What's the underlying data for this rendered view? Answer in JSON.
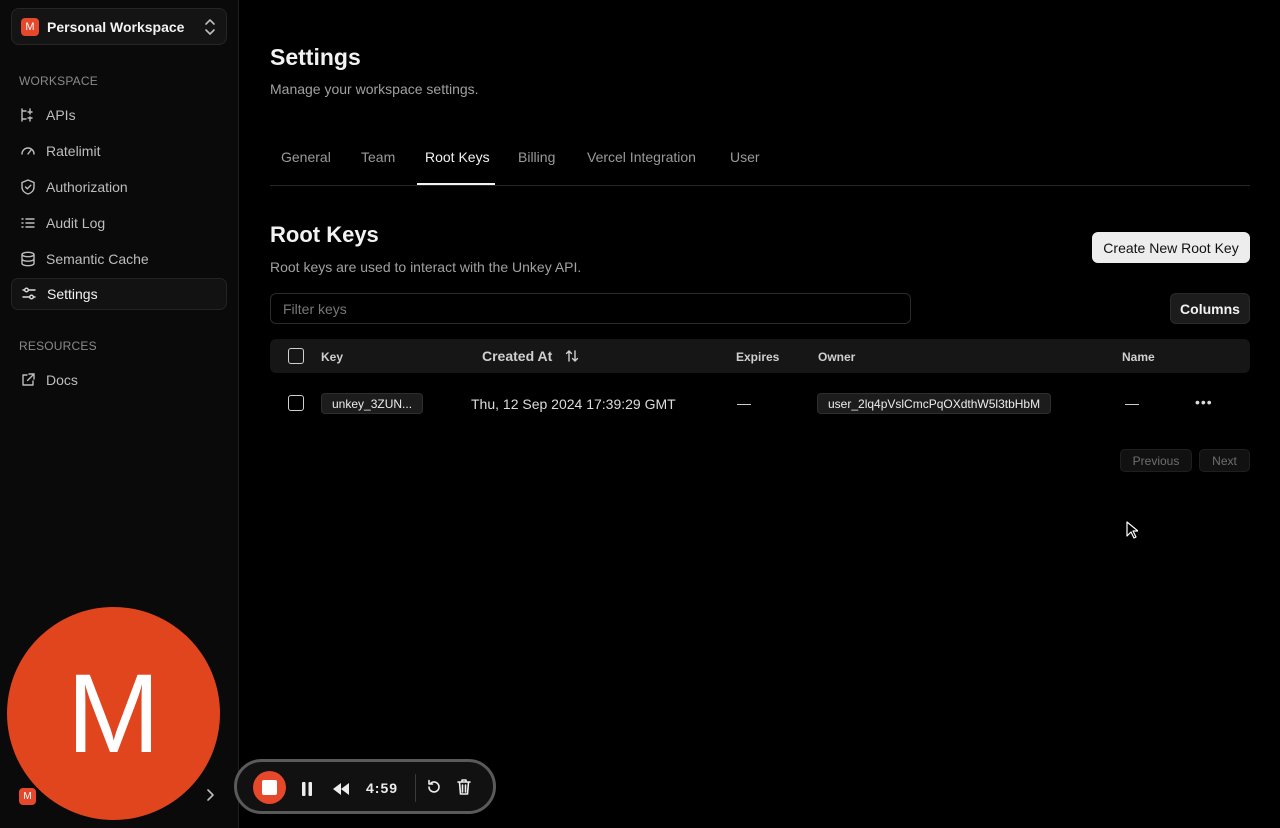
{
  "workspace": {
    "badge": "M",
    "name": "Personal Workspace"
  },
  "sidebar": {
    "workspace_label": "WORKSPACE",
    "items": [
      {
        "label": "APIs",
        "icon": "apis-icon"
      },
      {
        "label": "Ratelimit",
        "icon": "gauge-icon"
      },
      {
        "label": "Authorization",
        "icon": "shield-check-icon"
      },
      {
        "label": "Audit Log",
        "icon": "list-icon"
      },
      {
        "label": "Semantic Cache",
        "icon": "database-icon"
      },
      {
        "label": "Settings",
        "icon": "settings-sliders-icon",
        "active": true
      }
    ],
    "resources_label": "RESOURCES",
    "resources": [
      {
        "label": "Docs",
        "icon": "external-link-icon"
      }
    ],
    "user_badge": "M"
  },
  "header": {
    "title": "Settings",
    "subtitle": "Manage your workspace settings."
  },
  "tabs": [
    {
      "label": "General"
    },
    {
      "label": "Team"
    },
    {
      "label": "Root Keys",
      "active": true
    },
    {
      "label": "Billing"
    },
    {
      "label": "Vercel Integration"
    },
    {
      "label": "User"
    }
  ],
  "section": {
    "title": "Root Keys",
    "subtitle": "Root keys are used to interact with the Unkey API.",
    "create_label": "Create New Root Key"
  },
  "filter": {
    "placeholder": "Filter keys",
    "value": ""
  },
  "columns_label": "Columns",
  "table": {
    "headers": {
      "key": "Key",
      "created": "Created At",
      "expires": "Expires",
      "owner": "Owner",
      "name": "Name"
    },
    "rows": [
      {
        "key": "unkey_3ZUN...",
        "created": "Thu, 12 Sep 2024 17:39:29 GMT",
        "expires": "—",
        "owner": "user_2lq4pVslCmcPqOXdthW5l3tbHbM",
        "name": "—"
      }
    ]
  },
  "pagination": {
    "previous": "Previous",
    "next": "Next"
  },
  "recorder": {
    "avatar_letter": "M",
    "time": "4:59",
    "accent": "#e5482a"
  }
}
